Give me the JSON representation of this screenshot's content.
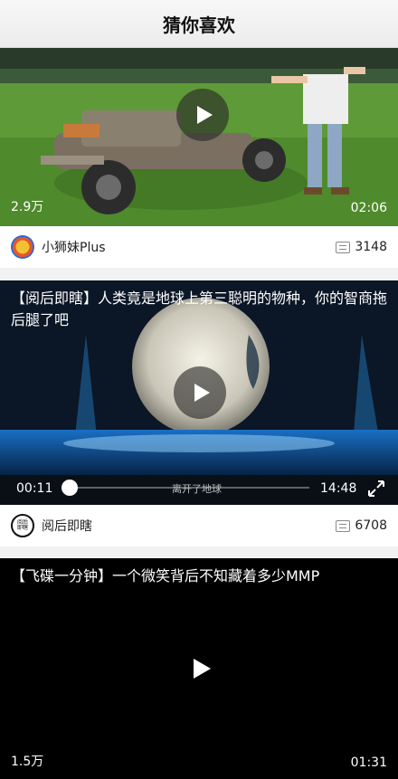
{
  "header": {
    "title": "猜你喜欢"
  },
  "videos": [
    {
      "views": "2.9万",
      "duration": "02:06",
      "author": "小狮妹Plus",
      "comments": "3148",
      "icon": "play-icon"
    },
    {
      "title": "【阅后即瞎】人类竟是地球上第三聪明的物种，你的智商拖后腿了吧",
      "current_time": "00:11",
      "total_time": "14:48",
      "caption": "离开了地球",
      "progress": 0.012,
      "author": "阅后即瞎",
      "comments": "6708",
      "avatar_text": "阅后即瞎"
    },
    {
      "title": "【飞碟一分钟】一个微笑背后不知藏着多少MMP",
      "views": "1.5万",
      "duration": "01:31"
    }
  ],
  "colors": {
    "accent": "#ffffff",
    "background": "#f2f2f2",
    "text": "#222222"
  }
}
